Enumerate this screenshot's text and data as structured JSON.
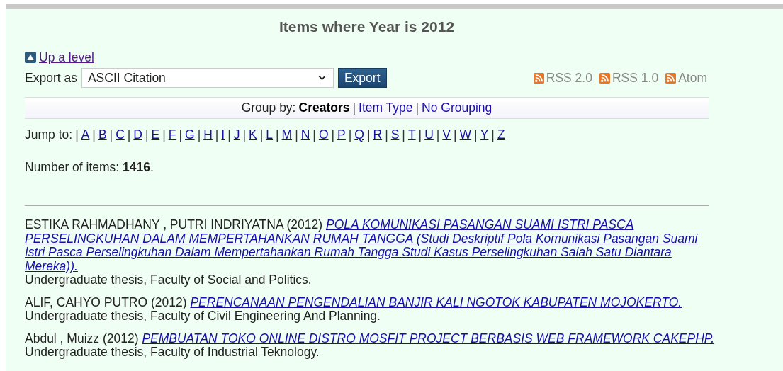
{
  "title": "Items where Year is 2012",
  "up_link": {
    "label": "Up a level"
  },
  "export": {
    "label": "Export as",
    "value": "ASCII Citation",
    "button": "Export"
  },
  "feeds": [
    {
      "label": "RSS 2.0"
    },
    {
      "label": "RSS 1.0"
    },
    {
      "label": "Atom"
    }
  ],
  "group_by": {
    "label": "Group by:",
    "separator": "|",
    "options": [
      {
        "label": "Creators",
        "selected": true
      },
      {
        "label": "Item Type",
        "selected": false
      },
      {
        "label": "No Grouping",
        "selected": false
      }
    ]
  },
  "jump_to": {
    "label": "Jump to:",
    "separator": "|",
    "letters": [
      "A",
      "B",
      "C",
      "D",
      "E",
      "F",
      "G",
      "H",
      "I",
      "J",
      "K",
      "L",
      "M",
      "N",
      "O",
      "P",
      "Q",
      "R",
      "S",
      "T",
      "U",
      "V",
      "W",
      "Y",
      "Z"
    ]
  },
  "count": {
    "label": "Number of items:",
    "value": "1416",
    "end": "."
  },
  "citations": [
    {
      "authors": "ESTIKA RAHMADHANY , PUTRI INDRIYATNA (2012)",
      "title": "POLA KOMUNIKASI PASANGAN SUAMI ISTRI PASCA PERSELINGKUHAN DALAM MEMPERTAHANKAN RUMAH TANGGA (Studi Deskriptif Pola Komunikasi Pasangan Suami Istri Pasca Perselingkuhan Dalam Mempertahankan Rumah Tangga Studi Kasus Perselingkuhan Salah Satu Diantara Mereka)).",
      "note": "Undergraduate thesis, Faculty of Social and Politics."
    },
    {
      "authors": "ALIF, CAHYO PUTRO (2012)",
      "title": "PERENCANAAN PENGENDALIAN BANJIR KALI NGOTOK KABUPATEN MOJOKERTO.",
      "note": "Undergraduate thesis, Faculty of Civil Engineering And Planning."
    },
    {
      "authors": "Abdul , Muizz (2012)",
      "title": "PEMBUATAN TOKO ONLINE DISTRO MOSFIT PROJECT BERBASIS WEB FRAMEWORK CAKEPHP.",
      "note": "Undergraduate thesis, Faculty of Industrial Teknology."
    }
  ]
}
